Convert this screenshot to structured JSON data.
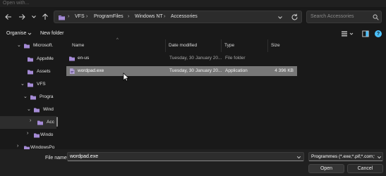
{
  "window": {
    "title": "Open with..."
  },
  "address": {
    "crumbs": [
      "VFS",
      "ProgramFiles",
      "Windows NT",
      "Accessories"
    ],
    "search_placeholder": "Search Accessories"
  },
  "toolbar": {
    "organise_label": "Organise",
    "new_folder_label": "New folder"
  },
  "tree": [
    {
      "label": "Microsoft.",
      "expanded": true
    },
    {
      "label": "AppxMe"
    },
    {
      "label": "Assets"
    },
    {
      "label": "VFS",
      "expanded": true
    },
    {
      "label": "Progra",
      "expanded": true
    },
    {
      "label": "Wind",
      "expanded": true
    },
    {
      "label": "Acc",
      "selected": true
    },
    {
      "label": "Windo"
    },
    {
      "label": "WindowsPo"
    }
  ],
  "columns": {
    "name": "Name",
    "date": "Date modified",
    "type": "Type",
    "size": "Size"
  },
  "files": [
    {
      "name": "en-us",
      "date": "Tuesday, 30 January 20...",
      "type": "File folder",
      "size": ""
    },
    {
      "name": "wordpad.exe",
      "date": "Tuesday, 30 January 20...",
      "type": "Application",
      "size": "4 396 KB"
    }
  ],
  "footer": {
    "file_name_label": "File name:",
    "file_name_value": "wordpad.exe",
    "filter_value": "Programmes (*.exe;*.pif;*.com;*.",
    "open_label": "Open",
    "cancel_label": "Cancel"
  },
  "colors": {
    "accent": "#4cc2ff",
    "selection": "#777777",
    "folder": "#a58bd6"
  }
}
